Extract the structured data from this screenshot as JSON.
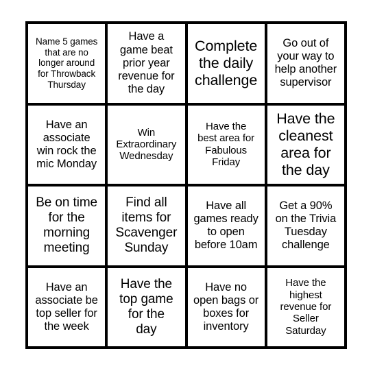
{
  "card": {
    "type": "bingo-card",
    "columns": 4,
    "rows": 4,
    "background_color": "#ffffff",
    "grid_line_color": "#000000",
    "cell_background_color": "#ffffff",
    "text_color": "#000000",
    "cells": [
      {
        "text": "Name 5 games\nthat are no\nlonger around\nfor Throwback\nThursday",
        "size": "fs-xs"
      },
      {
        "text": "Have a\ngame beat\nprior year\nrevenue for\nthe day",
        "size": "fs-md"
      },
      {
        "text": "Complete\nthe daily\nchallenge",
        "size": "fs-xl"
      },
      {
        "text": "Go out of\nyour way to\nhelp another\nsupervisor",
        "size": "fs-md"
      },
      {
        "text": "Have an\nassociate\nwin rock the\nmic Monday",
        "size": "fs-md"
      },
      {
        "text": "Win\nExtraordinary\nWednesday",
        "size": "fs-sm"
      },
      {
        "text": "Have the\nbest area for\nFabulous\nFriday",
        "size": "fs-sm"
      },
      {
        "text": "Have the\ncleanest\narea for\nthe day",
        "size": "fs-xl"
      },
      {
        "text": "Be on time\nfor the\nmorning\nmeeting",
        "size": "fs-lg"
      },
      {
        "text": "Find all\nitems for\nScavenger\nSunday",
        "size": "fs-lg"
      },
      {
        "text": "Have all\ngames ready\nto open\nbefore 10am",
        "size": "fs-md"
      },
      {
        "text": "Get a 90%\non the Trivia\nTuesday\nchallenge",
        "size": "fs-md"
      },
      {
        "text": "Have an\nassociate be\ntop seller for\nthe week",
        "size": "fs-md"
      },
      {
        "text": "Have the\ntop game\nfor the\nday",
        "size": "fs-lg"
      },
      {
        "text": "Have no\nopen bags or\nboxes for\ninventory",
        "size": "fs-md"
      },
      {
        "text": "Have the\nhighest\nrevenue for\nSeller\nSaturday",
        "size": "fs-sm"
      }
    ]
  }
}
